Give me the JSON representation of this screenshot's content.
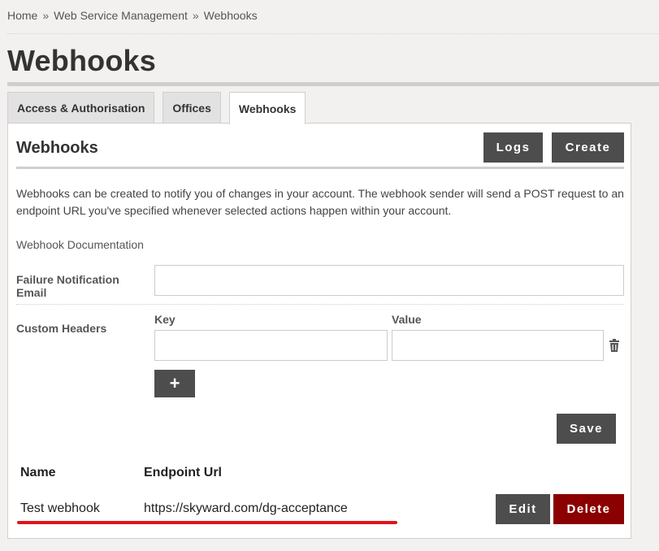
{
  "breadcrumb": {
    "items": [
      "Home",
      "Web Service Management",
      "Webhooks"
    ],
    "separator": "»"
  },
  "page_title": "Webhooks",
  "tabs": [
    {
      "label": "Access & Authorisation",
      "active": false
    },
    {
      "label": "Offices",
      "active": false
    },
    {
      "label": "Webhooks",
      "active": true
    }
  ],
  "panel": {
    "title": "Webhooks",
    "logs_label": "Logs",
    "create_label": "Create",
    "description": "Webhooks can be created to notify you of changes in your account. The webhook sender will send a POST request to an endpoint URL you've specified whenever selected actions happen within your account.",
    "doc_link": "Webhook Documentation"
  },
  "form": {
    "failure_email_label": "Failure Notification Email",
    "failure_email_value": "",
    "custom_headers_label": "Custom Headers",
    "key_label": "Key",
    "value_label": "Value",
    "key_value": "",
    "value_value": "",
    "add_label": "+",
    "save_label": "Save"
  },
  "table": {
    "headers": [
      "Name",
      "Endpoint Url"
    ],
    "rows": [
      {
        "name": "Test webhook",
        "url": "https://skyward.com/dg-acceptance"
      }
    ],
    "edit_label": "Edit",
    "delete_label": "Delete"
  },
  "colors": {
    "button_dark": "#4d4d4d",
    "delete_red": "#8b0000",
    "annotation_underline": "#e0141c",
    "background": "#f2f1ef"
  },
  "icons": {
    "trash": "trash-icon"
  }
}
